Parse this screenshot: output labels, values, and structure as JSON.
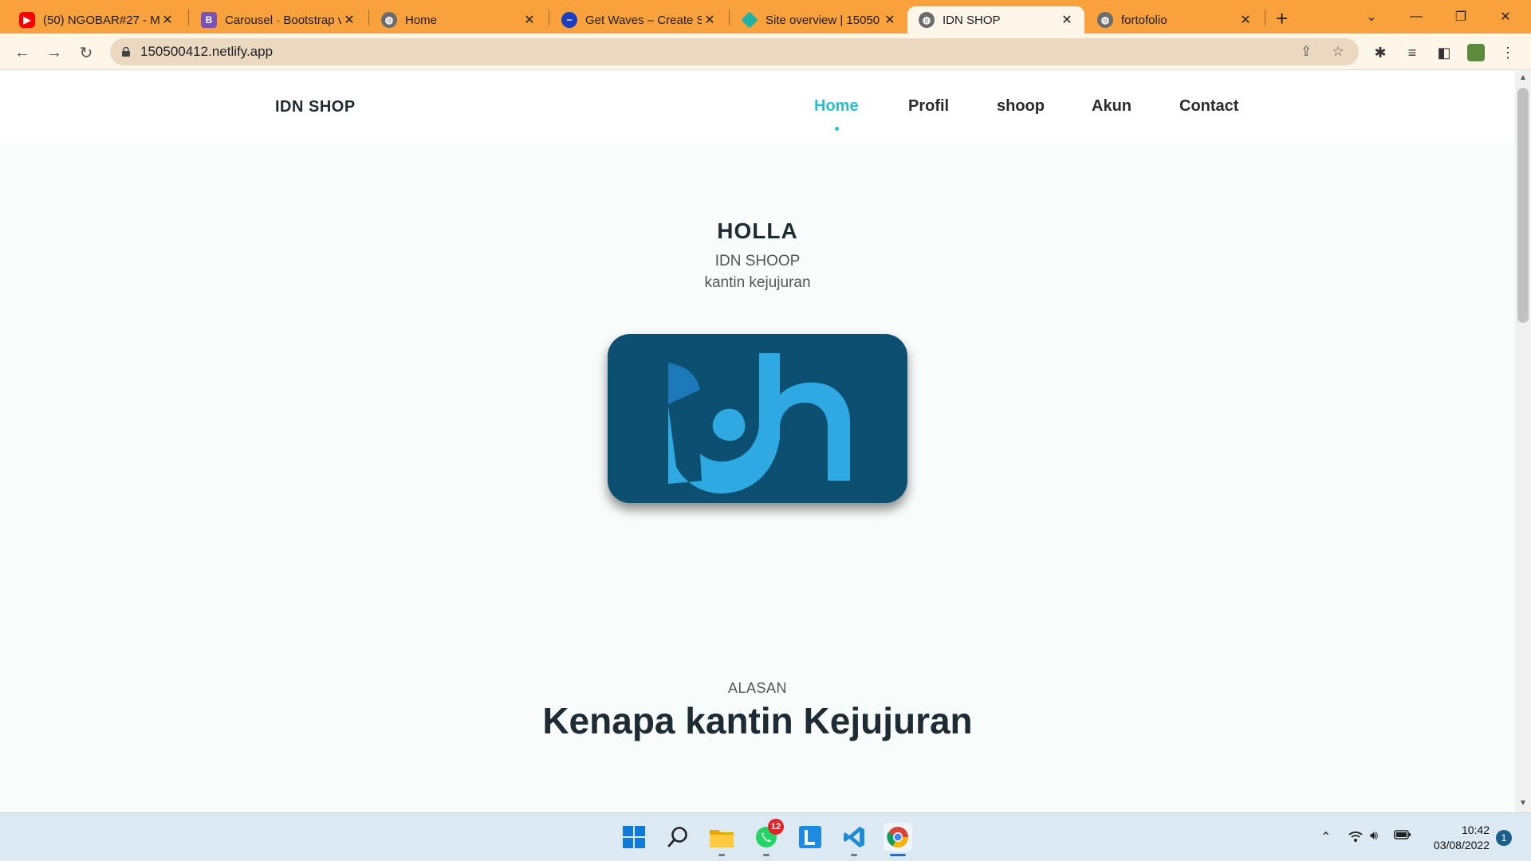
{
  "browser": {
    "tabs": [
      {
        "title": "(50) NGOBAR#27 - M",
        "icon": "youtube-icon",
        "color": "#ff0000"
      },
      {
        "title": "Carousel · Bootstrap v",
        "icon": "bootstrap-icon",
        "color": "#7952b3"
      },
      {
        "title": "Home",
        "icon": "globe-icon",
        "color": "#5f6368"
      },
      {
        "title": "Get Waves – Create S",
        "icon": "waves-icon",
        "color": "#1a3dc1"
      },
      {
        "title": "Site overview | 15050",
        "icon": "netlify-icon",
        "color": "#20b2a4"
      },
      {
        "title": "IDN SHOP",
        "icon": "globe-icon",
        "color": "#5f6368",
        "active": true
      },
      {
        "title": "fortofolio",
        "icon": "globe-icon",
        "color": "#5f6368"
      }
    ],
    "url": "150500412.netlify.app"
  },
  "site": {
    "brand": "IDN SHOP",
    "nav": [
      "Home",
      "Profil",
      "shoop",
      "Akun",
      "Contact"
    ],
    "active_nav": "Home",
    "accent_color": "#2ac0c9",
    "hero": {
      "title": "HOLLA",
      "subtitle1": "IDN SHOOP",
      "subtitle2": "kantin kejujuran"
    },
    "section": {
      "kicker": "ALASAN",
      "title": "Kenapa kantin Kejujuran"
    }
  },
  "taskbar": {
    "apps": [
      "windows-start-icon",
      "search-icon",
      "file-explorer-icon",
      "whatsapp-icon",
      "l-app-icon",
      "vscode-icon",
      "chrome-icon"
    ],
    "whatsapp_badge": "12",
    "time": "10:42",
    "date": "03/08/2022",
    "notifications": "1"
  }
}
